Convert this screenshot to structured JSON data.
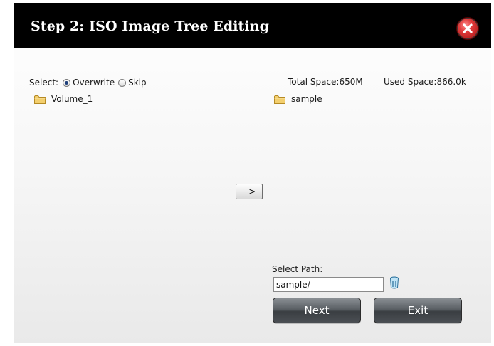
{
  "dialog": {
    "title": "Step 2: ISO Image Tree Editing",
    "close_icon": "close-icon"
  },
  "select": {
    "label": "Select:",
    "options": [
      {
        "label": "Overwrite",
        "checked": true
      },
      {
        "label": "Skip",
        "checked": false
      }
    ]
  },
  "space": {
    "total": "Total Space:650M",
    "used": "Used Space:866.0k"
  },
  "source_tree": {
    "items": [
      {
        "label": "Volume_1",
        "icon": "folder-icon"
      }
    ]
  },
  "target_tree": {
    "items": [
      {
        "label": "sample",
        "icon": "folder-icon"
      }
    ]
  },
  "move_button": {
    "label": "-->"
  },
  "path": {
    "label": "Select Path:",
    "value": "sample/",
    "trash_icon": "trash-icon"
  },
  "buttons": {
    "next": "Next",
    "exit": "Exit"
  },
  "colors": {
    "header_bg": "#000000",
    "header_text": "#ffffff",
    "close_red": "#e03a3a",
    "button_dark": "#4b4f54"
  }
}
